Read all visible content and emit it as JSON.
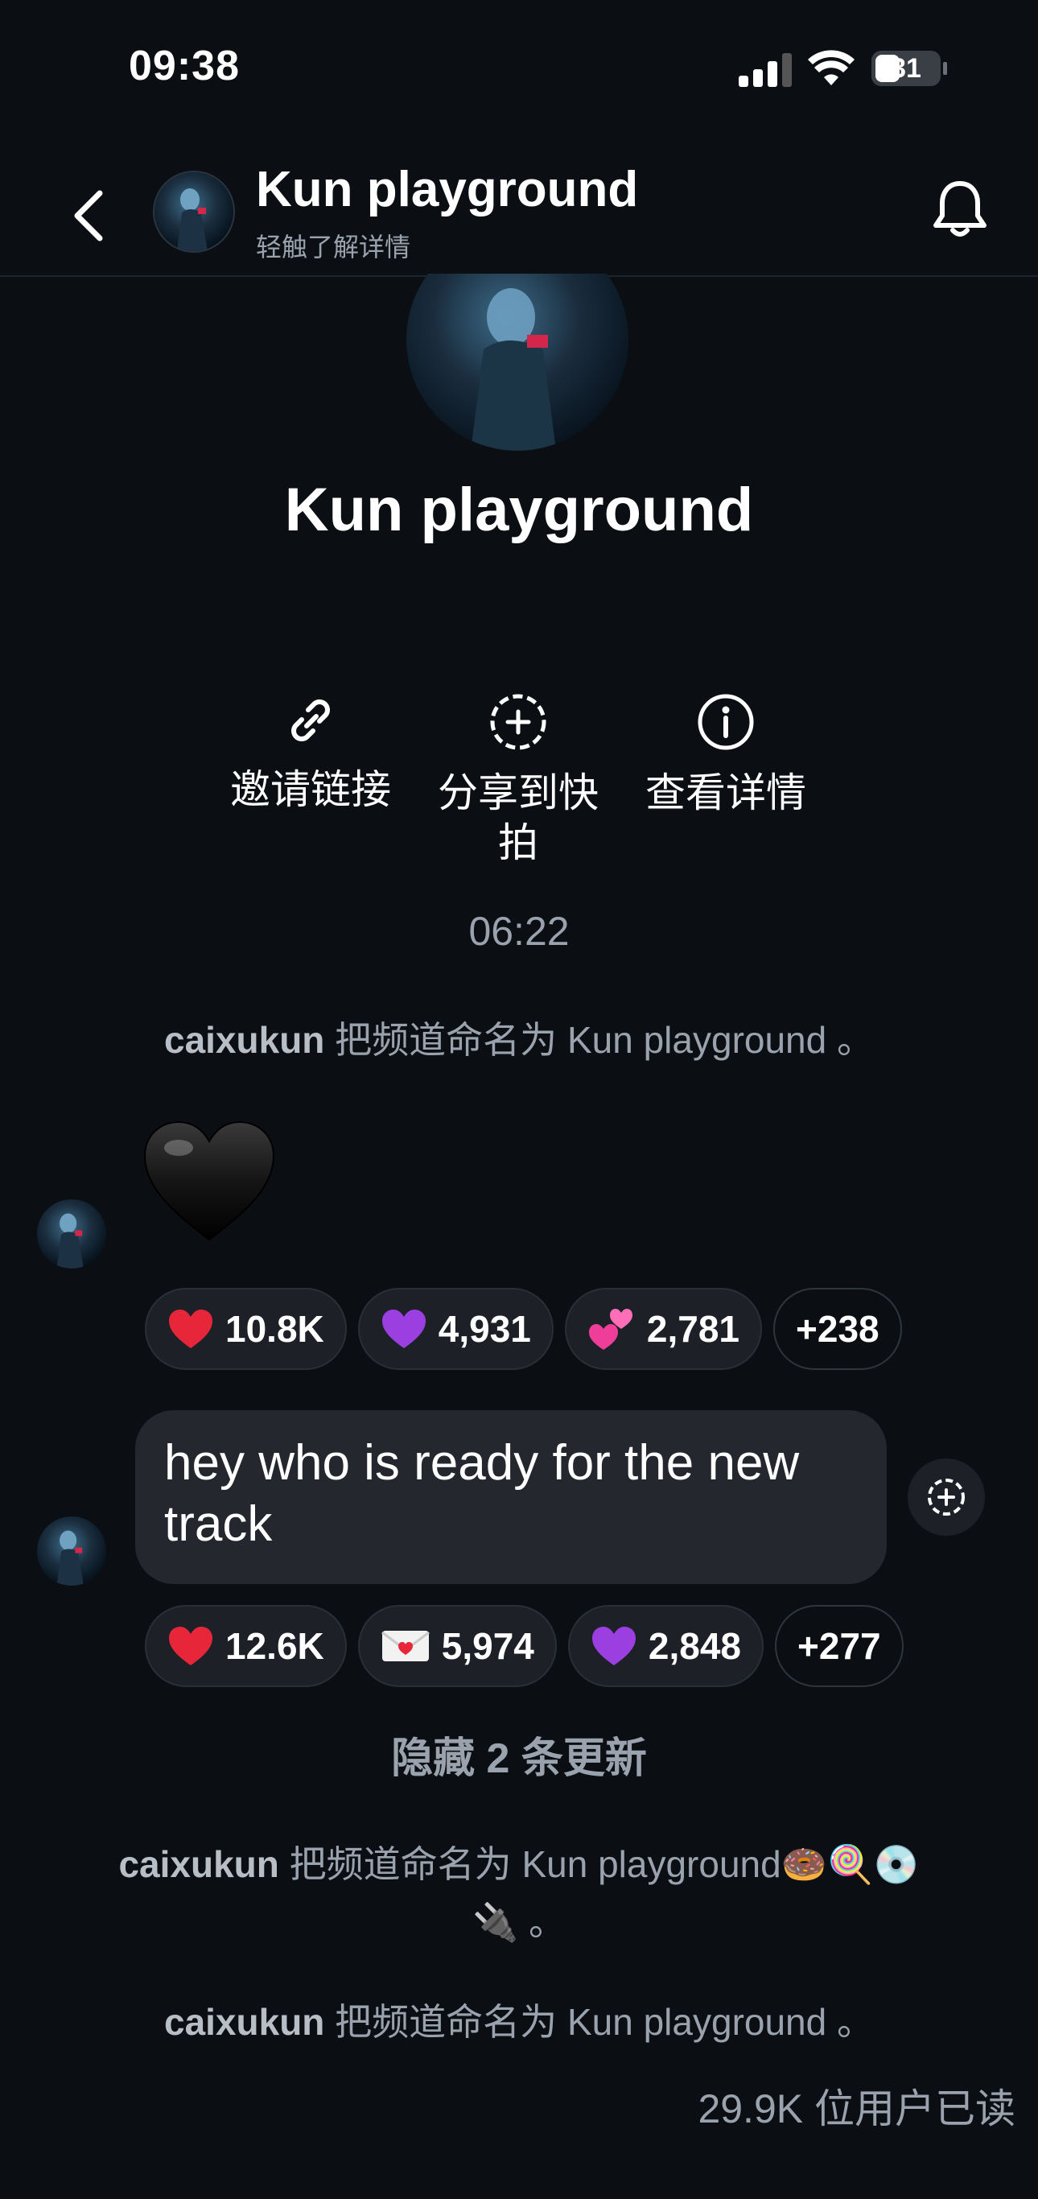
{
  "status_bar": {
    "time": "09:38",
    "battery": "31"
  },
  "header": {
    "title": "Kun playground",
    "subtitle": "轻触了解详情"
  },
  "profile": {
    "name": "Kun playground"
  },
  "actions": [
    {
      "label": "邀请链接",
      "icon": "link-icon"
    },
    {
      "label": "分享到快拍",
      "icon": "share-story-icon"
    },
    {
      "label": "查看详情",
      "icon": "info-icon"
    }
  ],
  "timestamp": "06:22",
  "system_messages": [
    {
      "user": "caixukun",
      "text": " 把频道命名为 Kun playground 。"
    },
    {
      "user": "caixukun",
      "text": " 把频道命名为 Kun playground🍩🍭💿🔌 。"
    },
    {
      "user": "caixukun",
      "text": " 把频道命名为 Kun playground 。"
    }
  ],
  "messages": [
    {
      "type": "emoji",
      "content": "black-heart",
      "reactions": [
        {
          "emoji": "red-heart",
          "count": "10.8K"
        },
        {
          "emoji": "purple-heart",
          "count": "4,931"
        },
        {
          "emoji": "two-hearts",
          "count": "2,781"
        },
        {
          "more": "+238"
        }
      ]
    },
    {
      "type": "text",
      "content": "hey who is ready for the new track",
      "reactions": [
        {
          "emoji": "red-heart",
          "count": "12.6K"
        },
        {
          "emoji": "love-letter",
          "count": "5,974"
        },
        {
          "emoji": "purple-heart",
          "count": "2,848"
        },
        {
          "more": "+277"
        }
      ]
    }
  ],
  "hidden_updates": "隐藏 2 条更新",
  "read_receipt": "29.9K 位用户已读",
  "colors": {
    "background": "#0b0f14",
    "bubble": "#24272d",
    "muted_text": "#9aa3ad",
    "heart_red": "#e8263a",
    "heart_purple": "#9b3fe0"
  }
}
